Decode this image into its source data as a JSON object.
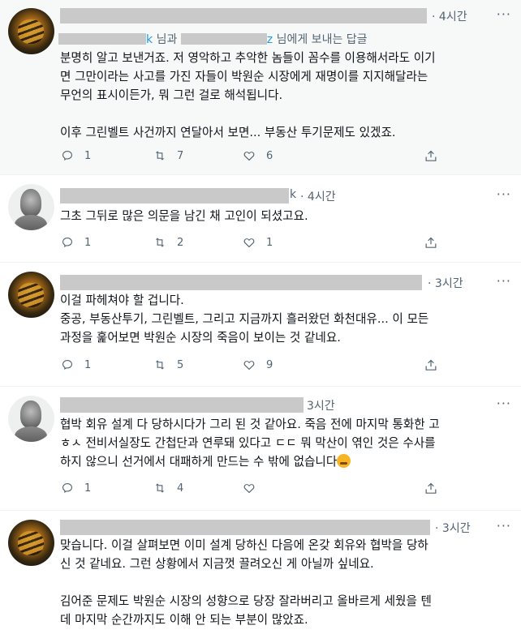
{
  "tweets": [
    {
      "time": "4시간",
      "reply_to": {
        "prefix_handle": "k",
        "middle": "님과",
        "suffix": "님에게 보내는 답글",
        "handle_tail": "z"
      },
      "body": "분명히 알고 보낸거죠. 저 영악하고 추악한 놈들이 꼼수를 이용해서라도 이기\n면 그만이라는 사고를 가진 자들이 박원순 시장에게 재명이를 지지해달라는\n무언의 표시이든가, 뭐 그런 걸로 해석됩니다.\n\n이후 그린벨트 사건까지 연달아서 보면... 부동산 투기문제도 있겠죠.",
      "replies": "1",
      "retweets": "7",
      "likes": "6"
    },
    {
      "time": "4시간",
      "name_fragment": "k",
      "body": "그초 그뒤로 많은 의문을 남긴 채 고인이 되셨고요.",
      "replies": "1",
      "retweets": "2",
      "likes": "1"
    },
    {
      "time": "3시간",
      "body": "이걸 파헤쳐야 할 겁니다.\n중공, 부동산투기, 그린벨트, 그리고 지금까지 흘러왔던 화천대유... 이 모든\n과정을 훑어보면 박원순 시장의 죽음이 보이는 것 같네요.",
      "replies": "1",
      "retweets": "5",
      "likes": "9"
    },
    {
      "time": "3시간",
      "body": "협박 회유 설계 다 당하시다가 그리 된 것 같아요. 죽음 전에 마지막 통화한 고\nㅎㅅ 전비서실장도 간첩단과 연루돼 있다고 ㄷㄷ 뭐 막산이 엮인 것은 수사를\n하지 않으니 선거에서 대패하게 만드는 수 밖에 없습니다",
      "replies": "1",
      "retweets": "4",
      "likes": ""
    },
    {
      "time": "3시간",
      "body": "맞습니다. 이걸 살펴보면 이미 설계 당하신 다음에 온갖 회유와 협박을 당하\n신 것 같네요. 그런 상황에서 지금껏 끌려오신 게 아닐까 싶네요.\n\n김어준 문제도 박원순 시장의 성향으로 당장 잘라버리고 올바르게 세웠을 텐\n데 마지막 순간까지도 이해 안 되는 부분이 많았죠."
    }
  ],
  "more_label": "···",
  "dot": "·"
}
